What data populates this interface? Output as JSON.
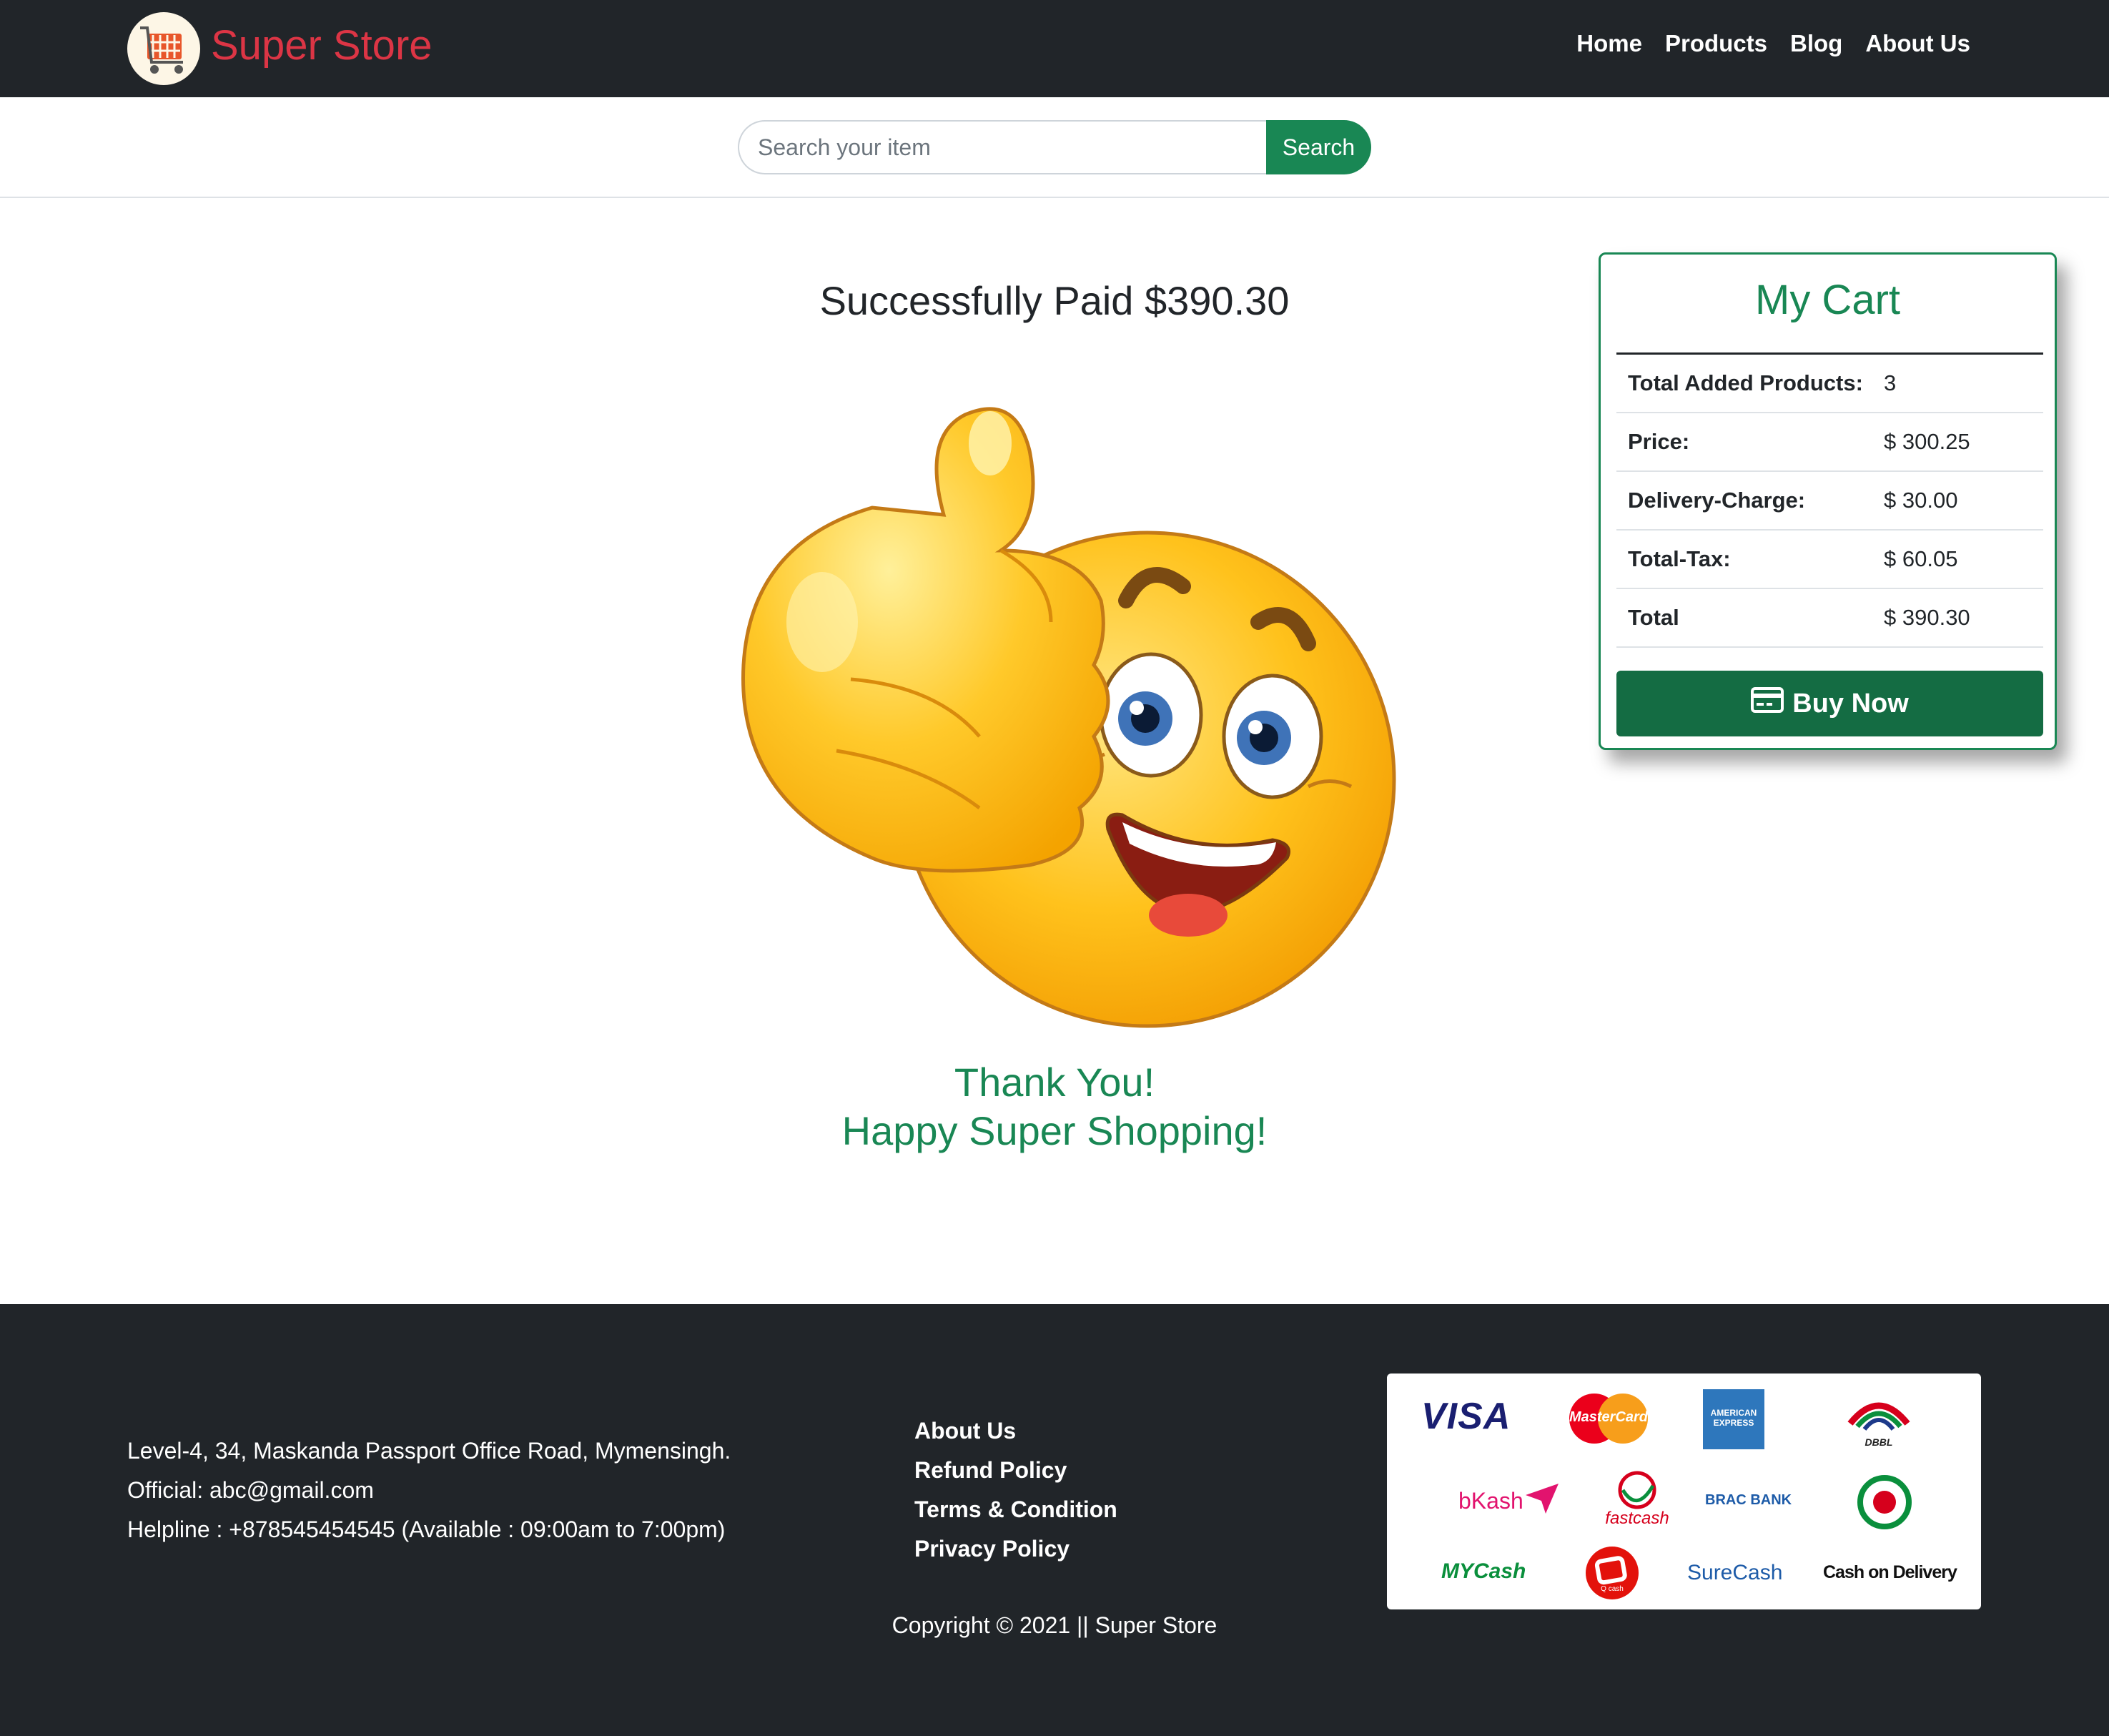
{
  "header": {
    "brand": "Super Store",
    "nav": [
      "Home",
      "Products",
      "Blog",
      "About Us"
    ]
  },
  "search": {
    "placeholder": "Search your item",
    "button": "Search"
  },
  "main": {
    "paid_message": "Successfully Paid $390.30",
    "thanks_line1": "Thank You!",
    "thanks_line2": "Happy Super Shopping!"
  },
  "cart": {
    "title": "My Cart",
    "rows": [
      {
        "label": "Total Added Products:",
        "value": "3"
      },
      {
        "label": "Price:",
        "value": "$ 300.25"
      },
      {
        "label": "Delivery-Charge:",
        "value": "$ 30.00"
      },
      {
        "label": "Total-Tax:",
        "value": "$ 60.05"
      },
      {
        "label": "Total",
        "value": "$ 390.30"
      }
    ],
    "buy_button": "Buy Now"
  },
  "footer": {
    "address": "Level-4, 34, Maskanda Passport Office Road, Mymensingh.",
    "official": "Official: abc@gmail.com",
    "helpline": "Helpline : +878545454545 (Available : 09:00am to 7:00pm)",
    "links": [
      "About Us",
      "Refund Policy",
      "Terms & Condition",
      "Privacy Policy"
    ],
    "copyright": "Copyright © 2021 || Super Store",
    "payment_methods": [
      "VISA",
      "MasterCard",
      "AMERICAN EXPRESS",
      "DBBL",
      "bKash",
      "fastcash",
      "BRAC BANK",
      "MYCash",
      "Q cash",
      "SureCash",
      "Cash on Delivery"
    ]
  },
  "colors": {
    "navbar": "#212529",
    "brand": "#dc3545",
    "accent_green": "#198754",
    "buy_green": "#146c43"
  }
}
